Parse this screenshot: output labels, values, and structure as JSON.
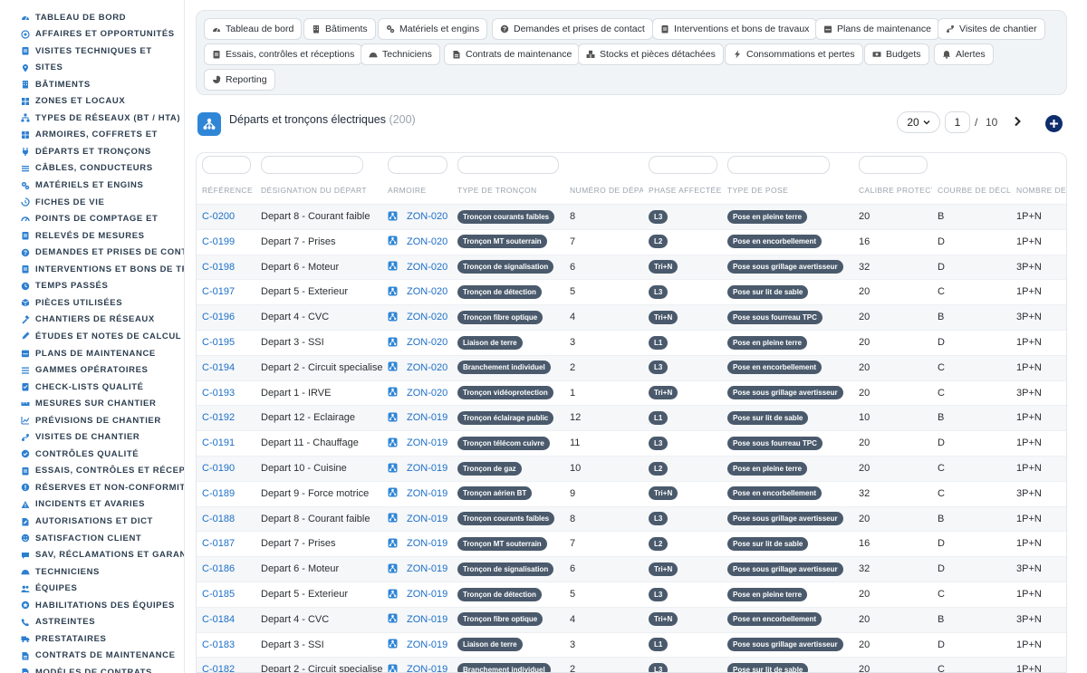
{
  "colors": {
    "accent": "#1d6fc7",
    "pill": "#4a5a6c",
    "add": "#0d2d6c",
    "sidebar_text": "#2c3e50"
  },
  "sidebar": {
    "items": [
      {
        "label": "TABLEAU DE BORD",
        "icon": "dashboard-icon"
      },
      {
        "label": "AFFAIRES ET OPPORTUNITÉS",
        "icon": "target-icon"
      },
      {
        "label": "VISITES TECHNIQUES ET",
        "icon": "clipboard-icon"
      },
      {
        "label": "SITES",
        "icon": "pin-icon"
      },
      {
        "label": "BÂTIMENTS",
        "icon": "building-icon"
      },
      {
        "label": "ZONES ET LOCAUX",
        "icon": "grid-icon"
      },
      {
        "label": "TYPES DE RÉSEAUX (BT / HTA)",
        "icon": "network-icon"
      },
      {
        "label": "ARMOIRES, COFFRETS ET",
        "icon": "cabinet-icon"
      },
      {
        "label": "DÉPARTS ET TRONÇONS",
        "icon": "plug-icon"
      },
      {
        "label": "CÂBLES, CONDUCTEURS",
        "icon": "cable-icon"
      },
      {
        "label": "MATÉRIELS ET ENGINS",
        "icon": "gears-icon"
      },
      {
        "label": "FICHES DE VIE",
        "icon": "history-icon"
      },
      {
        "label": "POINTS DE COMPTAGE ET",
        "icon": "gauge-icon"
      },
      {
        "label": "RELEVÉS DE MESURES",
        "icon": "clipboard-icon"
      },
      {
        "label": "DEMANDES ET PRISES DE CONTACT",
        "icon": "question-icon"
      },
      {
        "label": "INTERVENTIONS ET BONS DE TRAVAUX",
        "icon": "clipboard-icon"
      },
      {
        "label": "TEMPS PASSÉS",
        "icon": "clock-icon"
      },
      {
        "label": "PIÈCES UTILISÉES",
        "icon": "box-icon"
      },
      {
        "label": "CHANTIERS DE RÉSEAUX",
        "icon": "hammer-icon"
      },
      {
        "label": "ÉTUDES ET NOTES DE CALCUL",
        "icon": "edit-icon"
      },
      {
        "label": "PLANS DE MAINTENANCE",
        "icon": "calendar-icon"
      },
      {
        "label": "GAMMES OPÉRATOIRES",
        "icon": "list-icon"
      },
      {
        "label": "CHECK-LISTS QUALITÉ",
        "icon": "checklist-icon"
      },
      {
        "label": "MESURES SUR CHANTIER",
        "icon": "ruler-icon"
      },
      {
        "label": "PRÉVISIONS DE CHANTIER",
        "icon": "chart-icon"
      },
      {
        "label": "VISITES DE CHANTIER",
        "icon": "route-icon"
      },
      {
        "label": "CONTRÔLES QUALITÉ",
        "icon": "check-icon"
      },
      {
        "label": "ESSAIS, CONTRÔLES ET RÉCEPTIONS",
        "icon": "clipboard-icon"
      },
      {
        "label": "RÉSERVES ET NON-CONFORMITÉS",
        "icon": "alert-circle-icon"
      },
      {
        "label": "INCIDENTS ET AVARIES",
        "icon": "warning-icon"
      },
      {
        "label": "AUTORISATIONS ET DICT",
        "icon": "file-edit-icon"
      },
      {
        "label": "SATISFACTION CLIENT",
        "icon": "smile-icon"
      },
      {
        "label": "SAV, RÉCLAMATIONS ET GARANTIES",
        "icon": "comment-icon"
      },
      {
        "label": "TECHNICIENS",
        "icon": "helmet-icon"
      },
      {
        "label": "ÉQUIPES",
        "icon": "users-icon"
      },
      {
        "label": "HABILITATIONS DES ÉQUIPES",
        "icon": "badge-icon"
      },
      {
        "label": "ASTREINTES",
        "icon": "phone-icon"
      },
      {
        "label": "PRESTATAIRES",
        "icon": "truck-icon"
      },
      {
        "label": "CONTRATS DE MAINTENANCE",
        "icon": "file-icon"
      },
      {
        "label": "MODÈLES DE CONTRATS",
        "icon": "file-icon"
      }
    ]
  },
  "topbar": {
    "tabs": [
      {
        "label": "Tableau de bord",
        "icon": "dashboard-icon"
      },
      {
        "label": "Bâtiments",
        "icon": "building-icon"
      },
      {
        "label": "Matériels et engins",
        "icon": "gears-icon"
      },
      {
        "label": "Demandes et prises de contact",
        "icon": "question-icon"
      },
      {
        "label": "Interventions et bons de travaux",
        "icon": "clipboard-icon"
      },
      {
        "label": "Plans de maintenance",
        "icon": "calendar-icon"
      },
      {
        "label": "Visites de chantier",
        "icon": "route-icon"
      },
      {
        "label": "Essais, contrôles et réceptions",
        "icon": "clipboard-icon"
      },
      {
        "label": "Techniciens",
        "icon": "helmet-icon"
      },
      {
        "label": "Contrats de maintenance",
        "icon": "file-icon"
      },
      {
        "label": "Stocks et pièces détachées",
        "icon": "boxes-icon"
      },
      {
        "label": "Consommations et pertes",
        "icon": "bolt-icon"
      },
      {
        "label": "Budgets",
        "icon": "money-icon"
      },
      {
        "label": "Alertes",
        "icon": "bell-icon"
      },
      {
        "label": "Reporting",
        "icon": "pie-icon"
      }
    ]
  },
  "page": {
    "title": "Départs et tronçons électriques",
    "count": "(200)",
    "icon": "network-tree-icon"
  },
  "pagination": {
    "per_page": "20",
    "current": "1",
    "separator": "/",
    "total": "10"
  },
  "table": {
    "columns": [
      "RÉFÉRENCE",
      "DÉSIGNATION DU DÉPART",
      "ARMOIRE",
      "TYPE DE TRONÇON",
      "NUMÉRO DE DÉPART",
      "PHASE AFFECTÉE",
      "TYPE DE POSE",
      "CALIBRE PROTECTION",
      "COURBE DE DÉCLENCHEMENT",
      "NOMBRE DE PÔLES"
    ],
    "rows": [
      [
        "C-0200",
        "Depart 8 - Courant faible",
        "ZON-020",
        "Tronçon courants faibles",
        "8",
        "L3",
        "Pose en pleine terre",
        "20",
        "B",
        "1P+N"
      ],
      [
        "C-0199",
        "Depart 7 - Prises",
        "ZON-020",
        "Tronçon MT souterrain",
        "7",
        "L2",
        "Pose en encorbellement",
        "16",
        "D",
        "1P+N"
      ],
      [
        "C-0198",
        "Depart 6 - Moteur",
        "ZON-020",
        "Tronçon de signalisation",
        "6",
        "Tri+N",
        "Pose sous grillage avertisseur",
        "32",
        "D",
        "3P+N"
      ],
      [
        "C-0197",
        "Depart 5 - Exterieur",
        "ZON-020",
        "Tronçon de détection",
        "5",
        "L3",
        "Pose sur lit de sable",
        "20",
        "C",
        "1P+N"
      ],
      [
        "C-0196",
        "Depart 4 - CVC",
        "ZON-020",
        "Tronçon fibre optique",
        "4",
        "Tri+N",
        "Pose sous fourreau TPC",
        "20",
        "B",
        "3P+N"
      ],
      [
        "C-0195",
        "Depart 3 - SSI",
        "ZON-020",
        "Liaison de terre",
        "3",
        "L1",
        "Pose en pleine terre",
        "20",
        "D",
        "1P+N"
      ],
      [
        "C-0194",
        "Depart 2 - Circuit specialise",
        "ZON-020",
        "Branchement individuel",
        "2",
        "L3",
        "Pose en encorbellement",
        "20",
        "C",
        "1P+N"
      ],
      [
        "C-0193",
        "Depart 1 - IRVE",
        "ZON-020",
        "Tronçon vidéoprotection",
        "1",
        "Tri+N",
        "Pose sous grillage avertisseur",
        "20",
        "C",
        "3P+N"
      ],
      [
        "C-0192",
        "Depart 12 - Eclairage",
        "ZON-019",
        "Tronçon éclairage public",
        "12",
        "L1",
        "Pose sur lit de sable",
        "10",
        "B",
        "1P+N"
      ],
      [
        "C-0191",
        "Depart 11 - Chauffage",
        "ZON-019",
        "Tronçon télécom cuivre",
        "11",
        "L3",
        "Pose sous fourreau TPC",
        "20",
        "D",
        "1P+N"
      ],
      [
        "C-0190",
        "Depart 10 - Cuisine",
        "ZON-019",
        "Tronçon de gaz",
        "10",
        "L2",
        "Pose en pleine terre",
        "20",
        "C",
        "1P+N"
      ],
      [
        "C-0189",
        "Depart 9 - Force motrice",
        "ZON-019",
        "Tronçon aérien BT",
        "9",
        "Tri+N",
        "Pose en encorbellement",
        "32",
        "C",
        "3P+N"
      ],
      [
        "C-0188",
        "Depart 8 - Courant faible",
        "ZON-019",
        "Tronçon courants faibles",
        "8",
        "L3",
        "Pose sous grillage avertisseur",
        "20",
        "B",
        "1P+N"
      ],
      [
        "C-0187",
        "Depart 7 - Prises",
        "ZON-019",
        "Tronçon MT souterrain",
        "7",
        "L2",
        "Pose sur lit de sable",
        "16",
        "D",
        "1P+N"
      ],
      [
        "C-0186",
        "Depart 6 - Moteur",
        "ZON-019",
        "Tronçon de signalisation",
        "6",
        "Tri+N",
        "Pose sous grillage avertisseur",
        "32",
        "D",
        "3P+N"
      ],
      [
        "C-0185",
        "Depart 5 - Exterieur",
        "ZON-019",
        "Tronçon de détection",
        "5",
        "L3",
        "Pose en pleine terre",
        "20",
        "C",
        "1P+N"
      ],
      [
        "C-0184",
        "Depart 4 - CVC",
        "ZON-019",
        "Tronçon fibre optique",
        "4",
        "Tri+N",
        "Pose en encorbellement",
        "20",
        "B",
        "3P+N"
      ],
      [
        "C-0183",
        "Depart 3 - SSI",
        "ZON-019",
        "Liaison de terre",
        "3",
        "L1",
        "Pose sous grillage avertisseur",
        "20",
        "D",
        "1P+N"
      ],
      [
        "C-0182",
        "Depart 2 - Circuit specialise",
        "ZON-019",
        "Branchement individuel",
        "2",
        "L3",
        "Pose sur lit de sable",
        "20",
        "C",
        "1P+N"
      ]
    ]
  }
}
